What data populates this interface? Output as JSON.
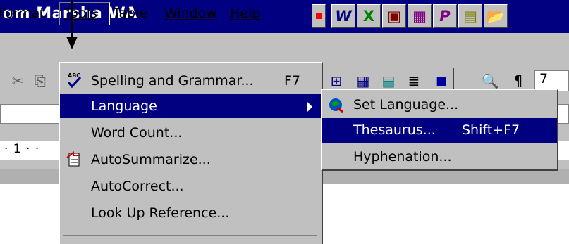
{
  "window": {
    "title": "om Marsha WA"
  },
  "title_icons": [
    "W",
    "X",
    "▣",
    "▦",
    "P",
    "▤",
    "📂"
  ],
  "menubar": {
    "items": [
      {
        "label": "Format",
        "underline": ""
      },
      {
        "label": "Tools"
      },
      {
        "label": "Table"
      },
      {
        "label": "Window"
      },
      {
        "label": "Help"
      }
    ]
  },
  "toolbar": {
    "left_icons": [
      "✂",
      "⎘"
    ],
    "right_icons": [
      "⊞",
      "▦",
      "▤",
      "≣",
      "◼",
      "🔍",
      "¶"
    ],
    "zoom_partial": "7"
  },
  "ruler": {
    "text": "· 1 · ·"
  },
  "tools_menu": {
    "items": [
      {
        "label": "Spelling and Grammar...",
        "shortcut": "F7",
        "icon": "spelling-check-icon"
      },
      {
        "label": "Language",
        "has_submenu": true,
        "highlighted": true
      },
      {
        "label": "Word Count..."
      },
      {
        "label": "AutoSummarize...",
        "icon": "autosummarize-icon"
      },
      {
        "label": "AutoCorrect..."
      },
      {
        "label": "Look Up Reference..."
      }
    ]
  },
  "language_submenu": {
    "items": [
      {
        "label": "Set Language...",
        "icon": "set-language-icon"
      },
      {
        "label": "Thesaurus...",
        "shortcut": "Shift+F7",
        "highlighted": true
      },
      {
        "label": "Hyphenation..."
      }
    ]
  },
  "colors": {
    "highlight": "#000080",
    "menu_bg": "#c0c0c0",
    "title_bg": "#000080"
  }
}
